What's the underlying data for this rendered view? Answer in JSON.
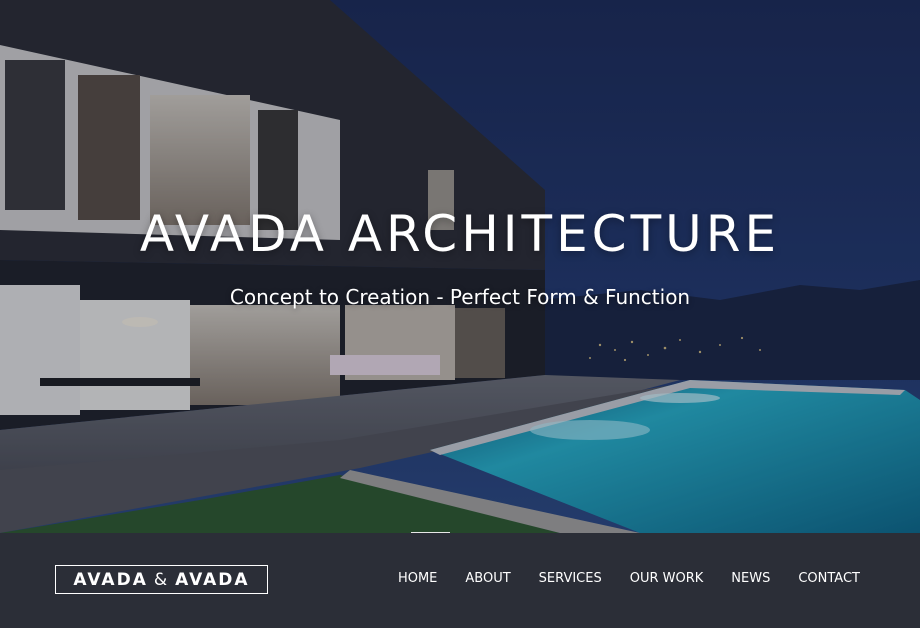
{
  "hero": {
    "title": "AVADA ARCHITECTURE",
    "subtitle": "Concept to Creation - Perfect Form & Function",
    "background_image": "modern-house-pool-at-dusk"
  },
  "logo": {
    "part1": "AVADA",
    "amp": "&",
    "part2": "AVADA"
  },
  "nav": {
    "items": [
      {
        "label": "HOME"
      },
      {
        "label": "ABOUT"
      },
      {
        "label": "SERVICES"
      },
      {
        "label": "OUR WORK"
      },
      {
        "label": "NEWS"
      },
      {
        "label": "CONTACT"
      }
    ]
  },
  "colors": {
    "navbar_bg": "#2b2e37",
    "text": "#ffffff",
    "sky": "#1f3366",
    "pool": "#2fc4d6"
  }
}
